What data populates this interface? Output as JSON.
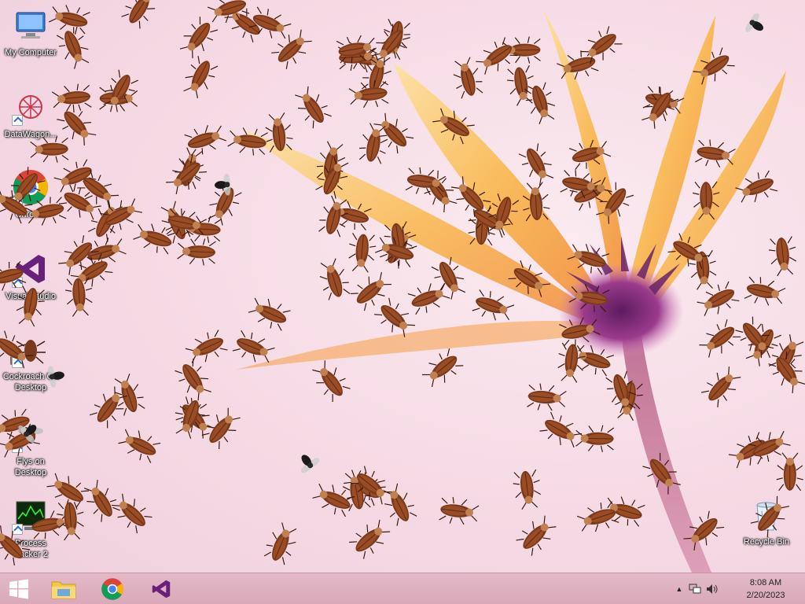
{
  "desktop": {
    "icons": [
      {
        "name": "desktop-icon-my-computer",
        "label": "My Computer"
      },
      {
        "name": "desktop-icon-datawagon",
        "label": "DataWagon..."
      },
      {
        "name": "desktop-icon-chrome",
        "label": "Chrome"
      },
      {
        "name": "desktop-icon-visual-studio",
        "label": "Visual Studio"
      },
      {
        "name": "desktop-icon-cockroach-desktop",
        "label": "Cockroach On Desktop"
      },
      {
        "name": "desktop-icon-flys-desktop",
        "label": "Flys on Desktop"
      },
      {
        "name": "desktop-icon-process-hacker",
        "label": "Process Hacker 2"
      },
      {
        "name": "desktop-icon-recycle-bin",
        "label": "Recycle Bin"
      }
    ]
  },
  "taskbar": {
    "pinned": [
      "start-icon",
      "file-explorer-icon",
      "chrome-icon",
      "visual-studio-icon"
    ],
    "tray_arrow": "▲",
    "clock_time": "8:08 AM",
    "clock_date": "2/20/2023"
  },
  "colors": {
    "taskbar": "#d9a9b9",
    "roach_body": "#7a3a1c",
    "petal": "#f7b84a",
    "flower_center": "#8b2f7a"
  }
}
